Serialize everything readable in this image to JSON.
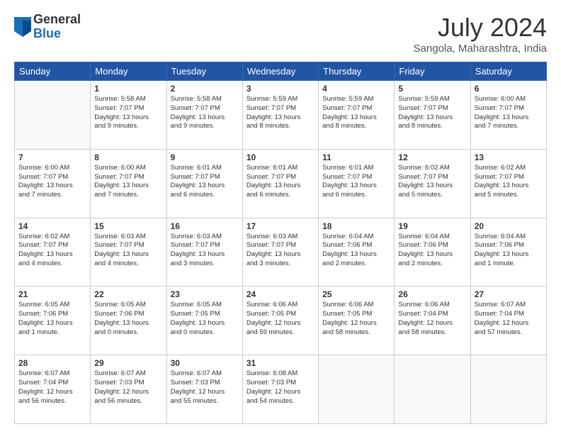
{
  "header": {
    "logo_general": "General",
    "logo_blue": "Blue",
    "month_year": "July 2024",
    "location": "Sangola, Maharashtra, India"
  },
  "days_of_week": [
    "Sunday",
    "Monday",
    "Tuesday",
    "Wednesday",
    "Thursday",
    "Friday",
    "Saturday"
  ],
  "weeks": [
    [
      {
        "day": "",
        "info": ""
      },
      {
        "day": "1",
        "info": "Sunrise: 5:58 AM\nSunset: 7:07 PM\nDaylight: 13 hours\nand 9 minutes."
      },
      {
        "day": "2",
        "info": "Sunrise: 5:58 AM\nSunset: 7:07 PM\nDaylight: 13 hours\nand 9 minutes."
      },
      {
        "day": "3",
        "info": "Sunrise: 5:59 AM\nSunset: 7:07 PM\nDaylight: 13 hours\nand 8 minutes."
      },
      {
        "day": "4",
        "info": "Sunrise: 5:59 AM\nSunset: 7:07 PM\nDaylight: 13 hours\nand 8 minutes."
      },
      {
        "day": "5",
        "info": "Sunrise: 5:59 AM\nSunset: 7:07 PM\nDaylight: 13 hours\nand 8 minutes."
      },
      {
        "day": "6",
        "info": "Sunrise: 6:00 AM\nSunset: 7:07 PM\nDaylight: 13 hours\nand 7 minutes."
      }
    ],
    [
      {
        "day": "7",
        "info": "Sunrise: 6:00 AM\nSunset: 7:07 PM\nDaylight: 13 hours\nand 7 minutes."
      },
      {
        "day": "8",
        "info": "Sunrise: 6:00 AM\nSunset: 7:07 PM\nDaylight: 13 hours\nand 7 minutes."
      },
      {
        "day": "9",
        "info": "Sunrise: 6:01 AM\nSunset: 7:07 PM\nDaylight: 13 hours\nand 6 minutes."
      },
      {
        "day": "10",
        "info": "Sunrise: 6:01 AM\nSunset: 7:07 PM\nDaylight: 13 hours\nand 6 minutes."
      },
      {
        "day": "11",
        "info": "Sunrise: 6:01 AM\nSunset: 7:07 PM\nDaylight: 13 hours\nand 6 minutes."
      },
      {
        "day": "12",
        "info": "Sunrise: 6:02 AM\nSunset: 7:07 PM\nDaylight: 13 hours\nand 5 minutes."
      },
      {
        "day": "13",
        "info": "Sunrise: 6:02 AM\nSunset: 7:07 PM\nDaylight: 13 hours\nand 5 minutes."
      }
    ],
    [
      {
        "day": "14",
        "info": "Sunrise: 6:02 AM\nSunset: 7:07 PM\nDaylight: 13 hours\nand 4 minutes."
      },
      {
        "day": "15",
        "info": "Sunrise: 6:03 AM\nSunset: 7:07 PM\nDaylight: 13 hours\nand 4 minutes."
      },
      {
        "day": "16",
        "info": "Sunrise: 6:03 AM\nSunset: 7:07 PM\nDaylight: 13 hours\nand 3 minutes."
      },
      {
        "day": "17",
        "info": "Sunrise: 6:03 AM\nSunset: 7:07 PM\nDaylight: 13 hours\nand 3 minutes."
      },
      {
        "day": "18",
        "info": "Sunrise: 6:04 AM\nSunset: 7:06 PM\nDaylight: 13 hours\nand 2 minutes."
      },
      {
        "day": "19",
        "info": "Sunrise: 6:04 AM\nSunset: 7:06 PM\nDaylight: 13 hours\nand 2 minutes."
      },
      {
        "day": "20",
        "info": "Sunrise: 6:04 AM\nSunset: 7:06 PM\nDaylight: 13 hours\nand 1 minute."
      }
    ],
    [
      {
        "day": "21",
        "info": "Sunrise: 6:05 AM\nSunset: 7:06 PM\nDaylight: 13 hours\nand 1 minute."
      },
      {
        "day": "22",
        "info": "Sunrise: 6:05 AM\nSunset: 7:06 PM\nDaylight: 13 hours\nand 0 minutes."
      },
      {
        "day": "23",
        "info": "Sunrise: 6:05 AM\nSunset: 7:05 PM\nDaylight: 13 hours\nand 0 minutes."
      },
      {
        "day": "24",
        "info": "Sunrise: 6:06 AM\nSunset: 7:05 PM\nDaylight: 12 hours\nand 59 minutes."
      },
      {
        "day": "25",
        "info": "Sunrise: 6:06 AM\nSunset: 7:05 PM\nDaylight: 12 hours\nand 58 minutes."
      },
      {
        "day": "26",
        "info": "Sunrise: 6:06 AM\nSunset: 7:04 PM\nDaylight: 12 hours\nand 58 minutes."
      },
      {
        "day": "27",
        "info": "Sunrise: 6:07 AM\nSunset: 7:04 PM\nDaylight: 12 hours\nand 57 minutes."
      }
    ],
    [
      {
        "day": "28",
        "info": "Sunrise: 6:07 AM\nSunset: 7:04 PM\nDaylight: 12 hours\nand 56 minutes."
      },
      {
        "day": "29",
        "info": "Sunrise: 6:07 AM\nSunset: 7:03 PM\nDaylight: 12 hours\nand 56 minutes."
      },
      {
        "day": "30",
        "info": "Sunrise: 6:07 AM\nSunset: 7:03 PM\nDaylight: 12 hours\nand 55 minutes."
      },
      {
        "day": "31",
        "info": "Sunrise: 6:08 AM\nSunset: 7:03 PM\nDaylight: 12 hours\nand 54 minutes."
      },
      {
        "day": "",
        "info": ""
      },
      {
        "day": "",
        "info": ""
      },
      {
        "day": "",
        "info": ""
      }
    ]
  ]
}
